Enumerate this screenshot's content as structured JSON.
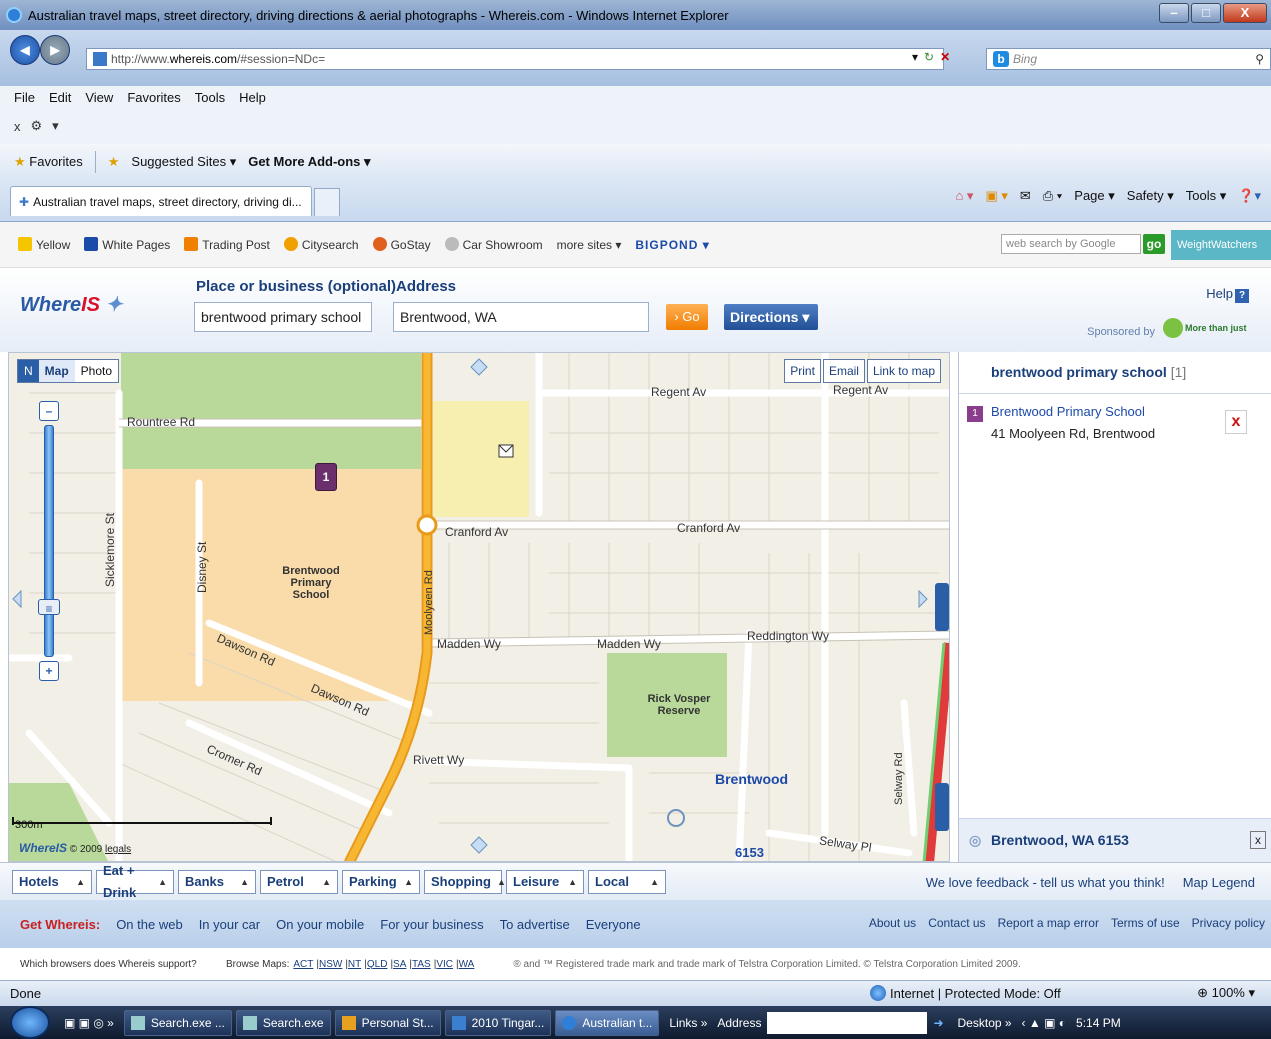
{
  "window": {
    "title": "Australian travel maps, street directory, driving directions & aerial photographs - Whereis.com - Windows Internet Explorer",
    "min": "–",
    "max": "□",
    "close": "X"
  },
  "address_bar": {
    "url_prefix": "http://www.",
    "url_domain": "whereis.com",
    "url_suffix": "/#session=NDc=",
    "search_placeholder": "Bing"
  },
  "menu": [
    "File",
    "Edit",
    "View",
    "Favorites",
    "Tools",
    "Help"
  ],
  "command_bar": {
    "close": "x",
    "dropdown": "▾"
  },
  "favorites_bar": {
    "favorites": "Favorites",
    "suggested": "Suggested Sites ▾",
    "addons": "Get More Add-ons ▾"
  },
  "tab": {
    "label": "Australian travel maps, street directory, driving di..."
  },
  "tab_tools": [
    "Page ▾",
    "Safety ▾",
    "Tools ▾"
  ],
  "sites_bar": {
    "items": [
      "Yellow",
      "White Pages",
      "Trading Post",
      "Citysearch",
      "GoStay",
      "Car Showroom",
      "more sites ▾"
    ],
    "bigpond": "BIGPOND ▾",
    "search_placeholder": "web search by Google",
    "go": "go",
    "weightwatchers": "WeightWatchers"
  },
  "search": {
    "logo_a": "Where",
    "logo_b": "IS",
    "place_label": "Place or business (optional)",
    "place_value": "brentwood primary school",
    "address_label": "Address",
    "address_value": "Brentwood, WA",
    "go": "› Go",
    "directions": "Directions ▾",
    "help": "Help",
    "help_icon": "?",
    "sponsored": "Sponsored by",
    "sponsor_tag": "More than just numbers"
  },
  "map": {
    "tabs": {
      "map": "Map",
      "photo": "Photo"
    },
    "tools": [
      "Print",
      "Email",
      "Link to map"
    ],
    "marker": "1",
    "scale": "300m",
    "copyright_logo": "WhereIS",
    "copyright": "© 2009",
    "legals": "legals",
    "labels": {
      "rountree": "Rountree Rd",
      "regent1": "Regent Av",
      "regent2": "Regent Av",
      "cranford1": "Cranford Av",
      "cranford2": "Cranford Av",
      "school": "Brentwood Primary School",
      "madden1": "Madden Wy",
      "madden2": "Madden Wy",
      "reddington": "Reddington Wy",
      "dawson1": "Dawson Rd",
      "dawson2": "Dawson Rd",
      "cromer": "Cromer Rd",
      "rivett": "Rivett Wy",
      "reserve": "Rick Vosper Reserve",
      "suburb": "Brentwood",
      "postcode": "6153",
      "selway": "Selway Pl",
      "sicklemore": "Sicklemore St",
      "disney": "Disney St",
      "moolyeen": "Moolyeen Rd",
      "selwayrd": "Selway Rd"
    }
  },
  "results": {
    "query": "brentwood primary school",
    "count": "[1]",
    "item_num": "1",
    "item_name": "Brentwood Primary School",
    "item_address": "41 Moolyeen Rd, Brentwood",
    "remove": "x",
    "footer": "Brentwood, WA 6153",
    "footer_close": "x"
  },
  "categories": [
    "Hotels",
    "Eat + Drink",
    "Banks",
    "Petrol",
    "Parking",
    "Shopping",
    "Leisure",
    "Local"
  ],
  "cat_links": [
    "We love feedback - tell us what you think!",
    "Map Legend"
  ],
  "footer_nav": {
    "get": "Get Whereis:",
    "items": [
      "On the web",
      "In your car",
      "On your mobile",
      "For your business",
      "To advertise",
      "Everyone"
    ],
    "right": [
      "About us",
      "Contact us",
      "Report a map error",
      "Terms of use",
      "Privacy policy"
    ]
  },
  "legal": {
    "browsers": "Which browsers does Whereis support?",
    "browse": "Browse Maps:",
    "states": [
      "ACT",
      "NSW",
      "NT",
      "QLD",
      "SA",
      "TAS",
      "VIC",
      "WA"
    ],
    "trademark": "® and ™ Registered trade mark and trade mark of Telstra Corporation Limited. © Telstra Corporation Limited 2009."
  },
  "status": {
    "left": "Done",
    "zone": "Internet | Protected Mode: Off",
    "zoom": "100%"
  },
  "taskbar": {
    "items": [
      "Search.exe ...",
      "Search.exe",
      "Personal St...",
      "2010 Tingar...",
      "Australian t..."
    ],
    "links": "Links »",
    "address": "Address",
    "desktop": "Desktop »",
    "time": "5:14 PM"
  }
}
